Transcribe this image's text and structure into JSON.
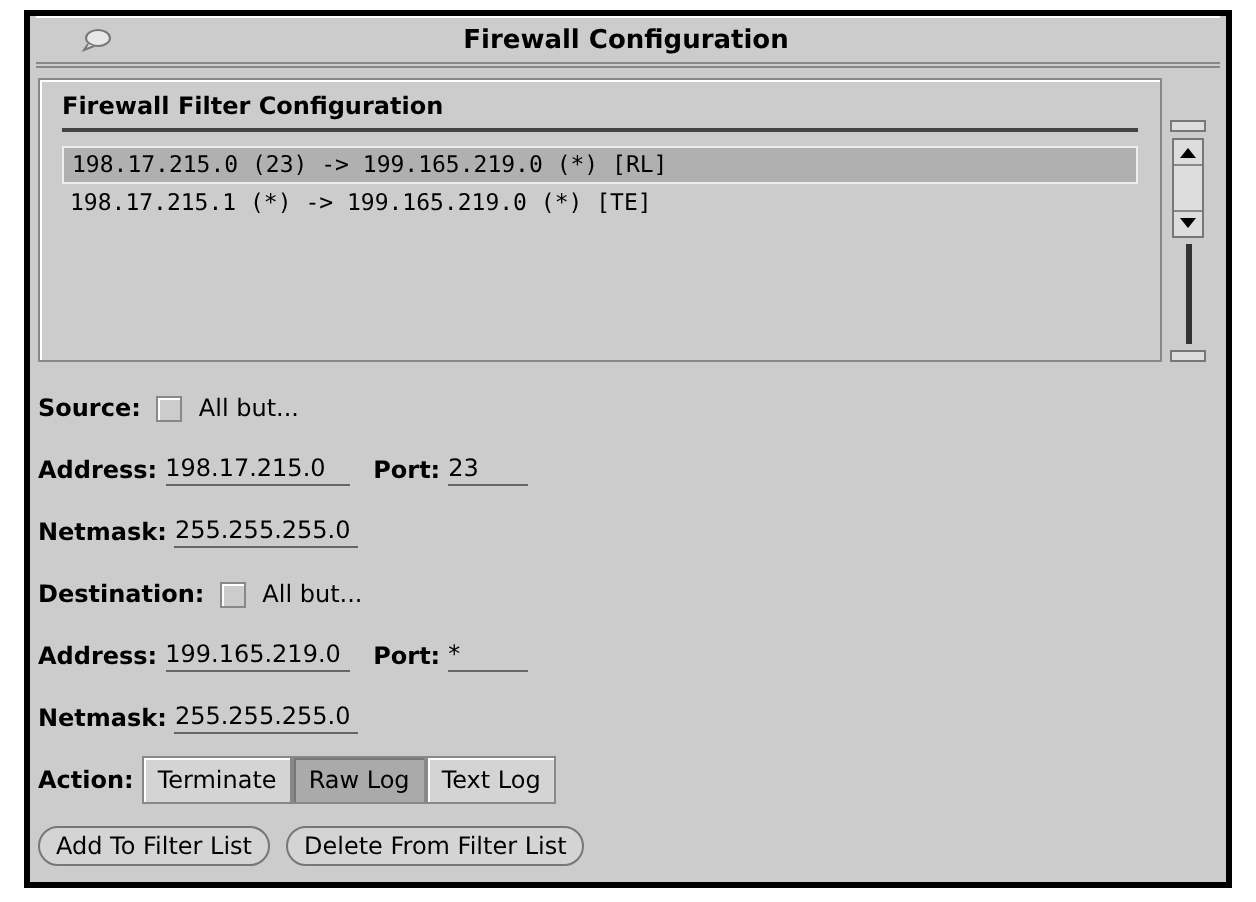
{
  "window": {
    "title": "Firewall Configuration"
  },
  "filter_list": {
    "title": "Firewall Filter Configuration",
    "items": [
      {
        "text": "198.17.215.0 (23) -> 199.165.219.0 (*) [RL]",
        "selected": true
      },
      {
        "text": "198.17.215.1 (*) -> 199.165.219.0 (*) [TE]",
        "selected": false
      }
    ]
  },
  "source": {
    "label": "Source:",
    "all_but": {
      "label": "All but...",
      "checked": false
    },
    "address": {
      "label": "Address:",
      "value": "198.17.215.0"
    },
    "port": {
      "label": "Port:",
      "value": "23"
    },
    "netmask": {
      "label": "Netmask:",
      "value": "255.255.255.0"
    }
  },
  "destination": {
    "label": "Destination:",
    "all_but": {
      "label": "All but...",
      "checked": false
    },
    "address": {
      "label": "Address:",
      "value": "199.165.219.0"
    },
    "port": {
      "label": "Port:",
      "value": "*"
    },
    "netmask": {
      "label": "Netmask:",
      "value": "255.255.255.0"
    }
  },
  "action": {
    "label": "Action:",
    "options": [
      {
        "label": "Terminate",
        "selected": false
      },
      {
        "label": "Raw Log",
        "selected": true
      },
      {
        "label": "Text Log",
        "selected": false
      }
    ]
  },
  "buttons": [
    "Add To Filter List",
    "Delete From Filter List"
  ]
}
